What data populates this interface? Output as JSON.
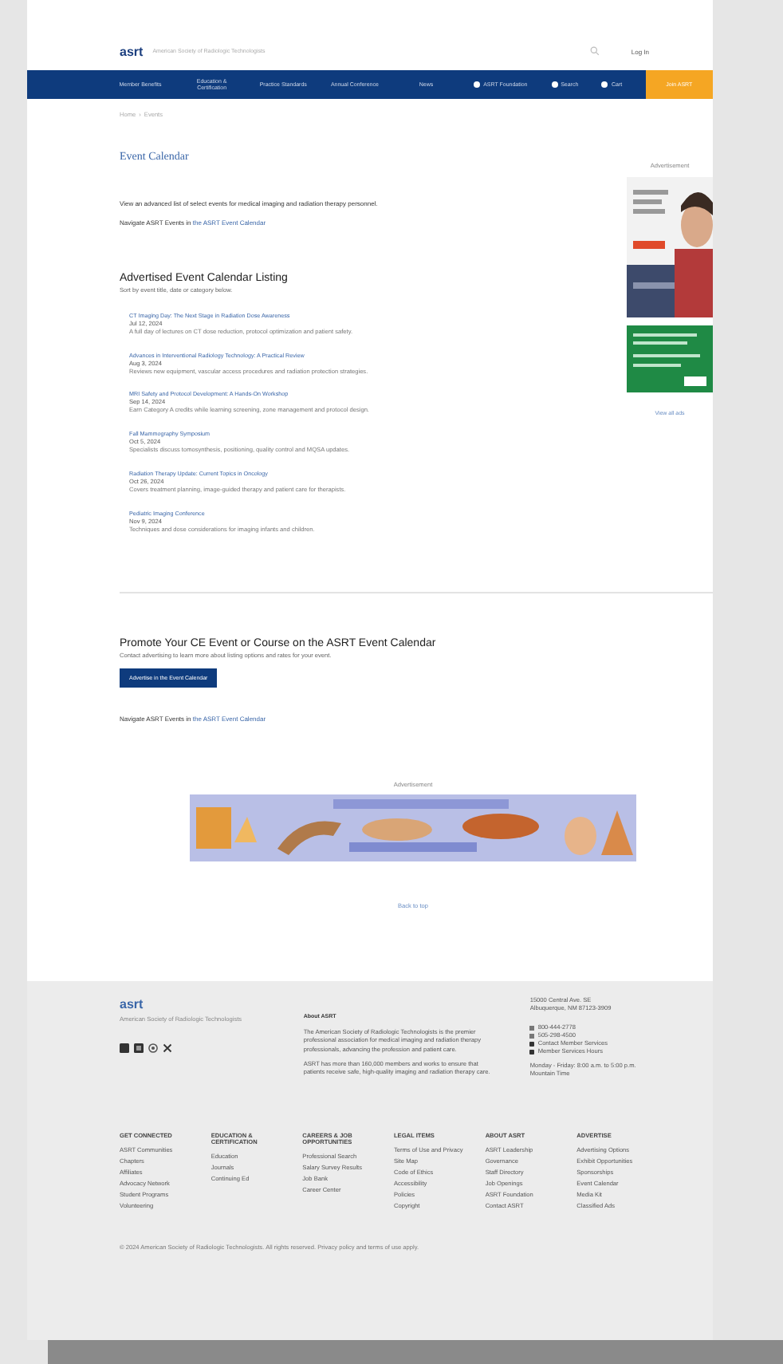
{
  "header": {
    "logo": "asrt",
    "tagline": "American Society of Radiologic Technologists",
    "login": "Log In"
  },
  "nav": [
    {
      "label": "Member Benefits",
      "kind": "text"
    },
    {
      "label": "Education & Certification",
      "kind": "text"
    },
    {
      "label": "Practice Standards",
      "kind": "text"
    },
    {
      "label": "Annual Conference",
      "kind": "text"
    },
    {
      "label": "News",
      "kind": "text"
    },
    {
      "label": "ASRT Foundation",
      "kind": "icon"
    },
    {
      "label": "Search",
      "kind": "icon"
    },
    {
      "label": "Cart",
      "kind": "icon"
    },
    {
      "label": "Join ASRT",
      "kind": "cta"
    }
  ],
  "breadcrumb": [
    "Home",
    "Events"
  ],
  "breadcrumb_separator": "›",
  "title": "Event Calendar",
  "intro": "View an advanced list of select events for medical imaging and radiation therapy personnel.",
  "intro_link": {
    "text": "Navigate ASRT Events in ",
    "link": "the ASRT Event Calendar"
  },
  "listing": {
    "heading": "Advertised Event Calendar Listing",
    "subheading": "Sort by event title, date or category below.",
    "events": [
      {
        "title": "CT Imaging Day: The Next Stage in Radiation Dose Awareness",
        "date": "Jul 12, 2024",
        "desc": "A full day of lectures on CT dose reduction, protocol optimization and patient safety."
      },
      {
        "title": "Advances in Interventional Radiology Technology: A Practical Review",
        "date": "Aug 3, 2024",
        "desc": "Reviews new equipment, vascular access procedures and radiation protection strategies."
      },
      {
        "title": "MRI Safety and Protocol Development: A Hands-On Workshop",
        "date": "Sep 14, 2024",
        "desc": "Earn Category A credits while learning screening, zone management and protocol design."
      },
      {
        "title": "Fall Mammography Symposium",
        "date": "Oct 5, 2024",
        "desc": "Specialists discuss tomosynthesis, positioning, quality control and MQSA updates."
      },
      {
        "title": "Radiation Therapy Update: Current Topics in Oncology",
        "date": "Oct 26, 2024",
        "desc": "Covers treatment planning, image-guided therapy and patient care for therapists."
      },
      {
        "title": "Pediatric Imaging Conference",
        "date": "Nov 9, 2024",
        "desc": "Techniques and dose considerations for imaging infants and children."
      }
    ]
  },
  "sidebar": {
    "label": "Advertisement",
    "link": "View all ads"
  },
  "promote": {
    "heading": "Promote Your CE Event or Course on the ASRT Event Calendar",
    "text": "Contact advertising to learn more about listing options and rates for your event.",
    "button": "Advertise in the Event Calendar",
    "link_text": "Navigate ASRT Events in ",
    "link": "the ASRT Event Calendar"
  },
  "banner": {
    "label": "Advertisement",
    "caption": "Back to top"
  },
  "footer": {
    "logo": "asrt",
    "tagline": "American Society of Radiologic Technologists",
    "about_title": "About ASRT",
    "about": [
      "The American Society of Radiologic Technologists is the premier professional association for medical imaging and radiation therapy professionals, advancing the profession and patient care.",
      "ASRT has more than 160,000 members and works to ensure that patients receive safe, high-quality imaging and radiation therapy care."
    ],
    "address": [
      "15000 Central Ave. SE",
      "Albuquerque, NM 87123-3909"
    ],
    "contacts": [
      "800-444-2778",
      "505-298-4500",
      "Contact Member Services",
      "Member Services Hours"
    ],
    "hours": "Monday - Friday: 8:00 a.m. to 5:00 p.m. Mountain Time",
    "columns": [
      {
        "heading": "GET CONNECTED",
        "links": [
          "ASRT Communities",
          "Chapters",
          "Affiliates",
          "Advocacy Network",
          "Student Programs",
          "Volunteering"
        ]
      },
      {
        "heading": "EDUCATION & CERTIFICATION",
        "links": [
          "Education",
          "Journals",
          "Continuing Ed"
        ]
      },
      {
        "heading": "CAREERS & JOB OPPORTUNITIES",
        "links": [
          "Professional Search",
          "Salary Survey Results",
          "Job Bank",
          "Career Center"
        ]
      },
      {
        "heading": "LEGAL ITEMS",
        "links": [
          "Terms of Use and Privacy",
          "Site Map",
          "Code of Ethics",
          "Accessibility",
          "Policies",
          "Copyright"
        ]
      },
      {
        "heading": "ABOUT ASRT",
        "links": [
          "ASRT Leadership",
          "Governance",
          "Staff Directory",
          "Job Openings",
          "ASRT Foundation",
          "Contact ASRT"
        ]
      },
      {
        "heading": "ADVERTISE",
        "links": [
          "Advertising Options",
          "Exhibit Opportunities",
          "Sponsorships",
          "Event Calendar",
          "Media Kit",
          "Classified Ads"
        ]
      }
    ],
    "copyright": "© 2024 American Society of Radiologic Technologists. All rights reserved. Privacy policy and terms of use apply."
  }
}
